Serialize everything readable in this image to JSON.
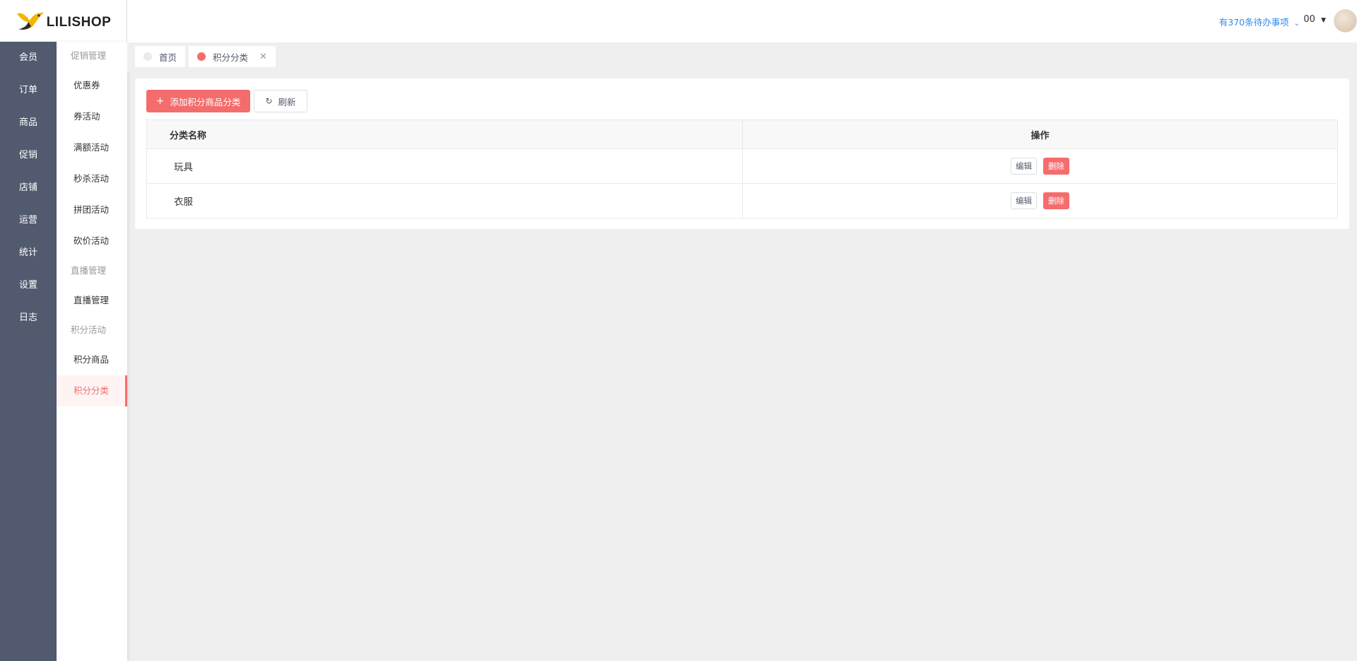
{
  "app": {
    "logo_text": "LILISHOP"
  },
  "rail": {
    "items": [
      {
        "label": "会员"
      },
      {
        "label": "订单"
      },
      {
        "label": "商品"
      },
      {
        "label": "促销"
      },
      {
        "label": "店铺"
      },
      {
        "label": "运营"
      },
      {
        "label": "统计"
      },
      {
        "label": "设置"
      },
      {
        "label": "日志"
      }
    ],
    "active_index": 3
  },
  "submenu": {
    "groups": [
      {
        "title": "促销管理",
        "items": [
          "优惠券",
          "券活动",
          "满额活动",
          "秒杀活动",
          "拼团活动",
          "砍价活动"
        ]
      },
      {
        "title": "直播管理",
        "items": [
          "直播管理"
        ]
      },
      {
        "title": "积分活动",
        "items": [
          "积分商品",
          "积分分类"
        ]
      }
    ],
    "active_item": "积分分类"
  },
  "header": {
    "todo_text": "有370条待办事项",
    "username": "00"
  },
  "tabs": [
    {
      "label": "首页",
      "dot_color": "#e8eaec",
      "closable": false
    },
    {
      "label": "积分分类",
      "dot_color": "#f56c6c",
      "closable": true
    }
  ],
  "toolbar": {
    "add_label": "添加积分商品分类",
    "refresh_label": "刷新"
  },
  "table": {
    "columns": [
      "分类名称",
      "操作"
    ],
    "rows": [
      {
        "name": "玩具"
      },
      {
        "name": "衣服"
      }
    ],
    "edit_label": "编辑",
    "delete_label": "删除"
  },
  "colors": {
    "accent": "#f56c6c",
    "rail_bg": "#515a6e",
    "link": "#2d8cf0"
  }
}
